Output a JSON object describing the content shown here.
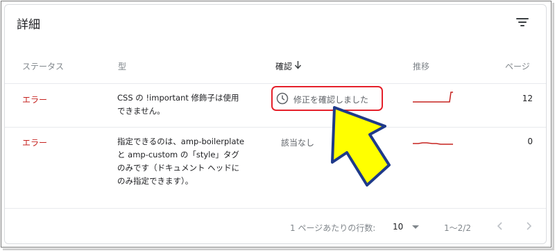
{
  "card": {
    "title": "詳細",
    "filter_icon": "filter-list-icon"
  },
  "columns": {
    "status": "ステータス",
    "type": "型",
    "validation": "確認",
    "trend": "推移",
    "pages": "ページ"
  },
  "sort": {
    "column": "validation",
    "direction": "descending",
    "icon": "arrow-down-icon"
  },
  "rows": [
    {
      "status": "エラー",
      "type": "CSS の !important 修飾子は使用できません。",
      "validation": "修正を確認しました",
      "validation_icon": "clock-icon",
      "pages": "12"
    },
    {
      "status": "エラー",
      "type": "指定できるのは、amp-boilerplate と amp-custom の「style」タグのみです（ドキュメント ヘッドにのみ指定できます）。",
      "validation": "該当なし",
      "pages": "0"
    }
  ],
  "footer": {
    "rows_per_page_label": "1 ページあたりの行数:",
    "rows_per_page_value": "10",
    "range": "1〜2/2",
    "prev_icon": "chevron-left-icon",
    "next_icon": "chevron-right-icon"
  },
  "colors": {
    "error": "#c5221f",
    "highlight": "#e5202a",
    "arrow_fill": "#ffff00",
    "arrow_stroke": "#1f3a8a"
  }
}
